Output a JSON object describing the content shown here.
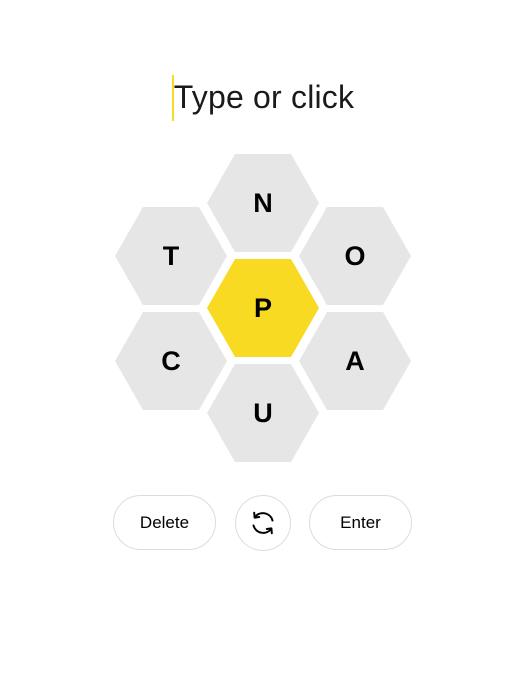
{
  "input": {
    "placeholder": "Type or click"
  },
  "hive": {
    "center_letter": "P",
    "outer_letters": [
      "N",
      "T",
      "O",
      "C",
      "A",
      "U"
    ]
  },
  "controls": {
    "delete_label": "Delete",
    "shuffle_icon": "shuffle-icon",
    "enter_label": "Enter"
  },
  "colors": {
    "center_cell": "#f7da21",
    "outer_cell": "#e6e6e6",
    "cursor": "#f7da21"
  }
}
